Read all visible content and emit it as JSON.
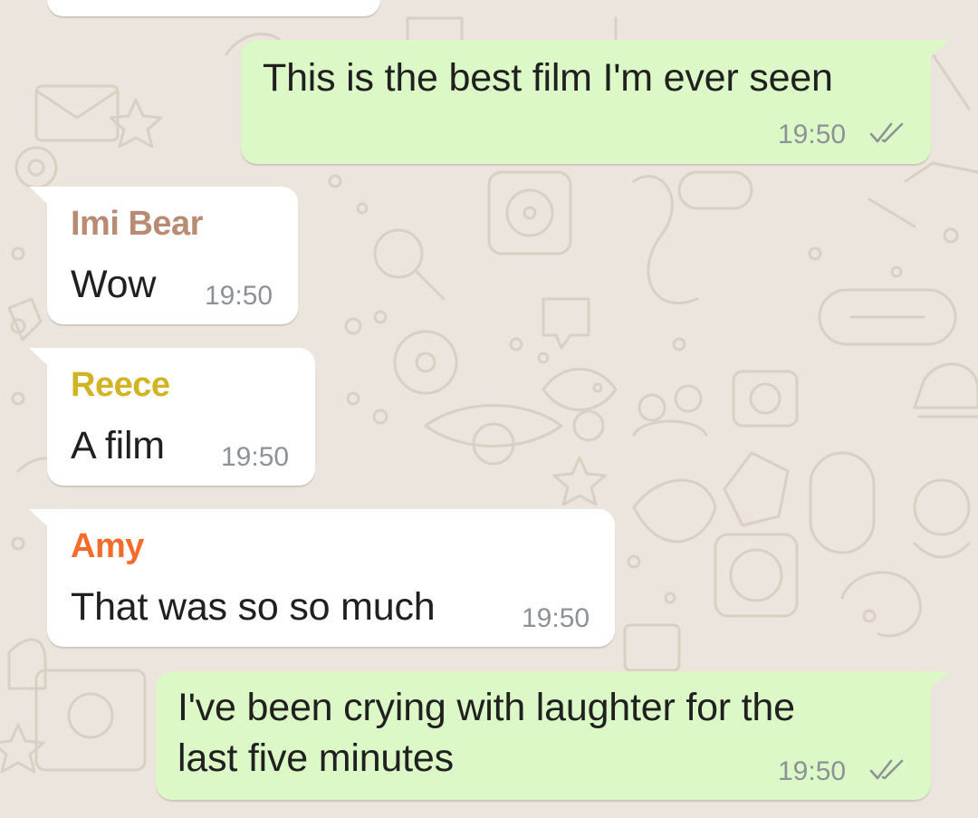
{
  "chat": {
    "messages": [
      {
        "direction": "outgoing",
        "text": "This is the best film I'm ever seen",
        "time": "19:50",
        "status_icon": "double-check-icon"
      },
      {
        "direction": "incoming",
        "sender": "Imi Bear",
        "sender_color": "#B88B72",
        "text": "Wow",
        "time": "19:50"
      },
      {
        "direction": "incoming",
        "sender": "Reece",
        "sender_color": "#D2B324",
        "text": "A film",
        "time": "19:50"
      },
      {
        "direction": "incoming",
        "sender": "Amy",
        "sender_color": "#F36C2C",
        "text": "That was so so much",
        "time": "19:50"
      },
      {
        "direction": "outgoing",
        "text_lines": [
          "I've been crying with laughter for the",
          "last five minutes"
        ],
        "time": "19:50",
        "status_icon": "double-check-icon"
      }
    ]
  },
  "colors": {
    "outgoing_bubble": "#DCF8C6",
    "incoming_bubble": "#FFFFFF",
    "wallpaper": "#ECE5DD",
    "timestamp": "#8D9298",
    "text": "#202020"
  }
}
